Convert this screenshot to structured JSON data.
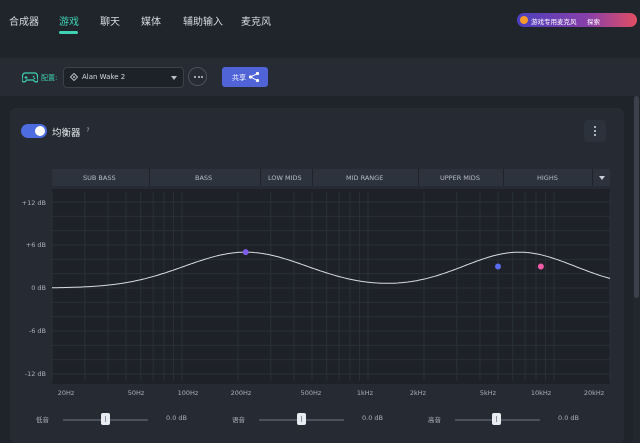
{
  "nav": {
    "tabs": [
      {
        "label": "合成器"
      },
      {
        "label": "游戏"
      },
      {
        "label": "聊天"
      },
      {
        "label": "媒体"
      },
      {
        "label": "辅助输入"
      },
      {
        "label": "麦克风"
      }
    ],
    "active_tab": "游戏",
    "promo": {
      "text": "游戏专用麦克风",
      "action": "探索"
    }
  },
  "config": {
    "label": "配置:",
    "selected": "Alan Wake 2",
    "share_label": "共享"
  },
  "equalizer": {
    "enabled": true,
    "title": "均衡器",
    "help": "?",
    "bands": [
      "SUB BASS",
      "BASS",
      "LOW MIDS",
      "MID RANGE",
      "UPPER MIDS",
      "HIGHS"
    ],
    "y_ticks": [
      "+12 dB",
      "+6 dB",
      "0 dB",
      "-6 dB",
      "-12 dB"
    ],
    "x_ticks": [
      "20Hz",
      "50Hz",
      "100Hz",
      "200Hz",
      "500Hz",
      "1kHz",
      "2kHz",
      "5kHz",
      "10kHz",
      "20kHz"
    ],
    "points": [
      {
        "freq_hz": 220,
        "gain_db": 5,
        "color": "#7c5ce6"
      },
      {
        "freq_hz": 5000,
        "gain_db": 3,
        "color": "#5a6cf0"
      },
      {
        "freq_hz": 8500,
        "gain_db": 3,
        "color": "#f15aa6"
      }
    ],
    "curve_color": "#d9dde3"
  },
  "sliders": [
    {
      "label": "低音",
      "value": "0.0 dB"
    },
    {
      "label": "语音",
      "value": "0.0 dB"
    },
    {
      "label": "高音",
      "value": "0.0 dB"
    }
  ],
  "colors": {
    "accent": "#3fd3b3",
    "share_button": "#5064d8",
    "toggle": "#4c6ce0"
  }
}
